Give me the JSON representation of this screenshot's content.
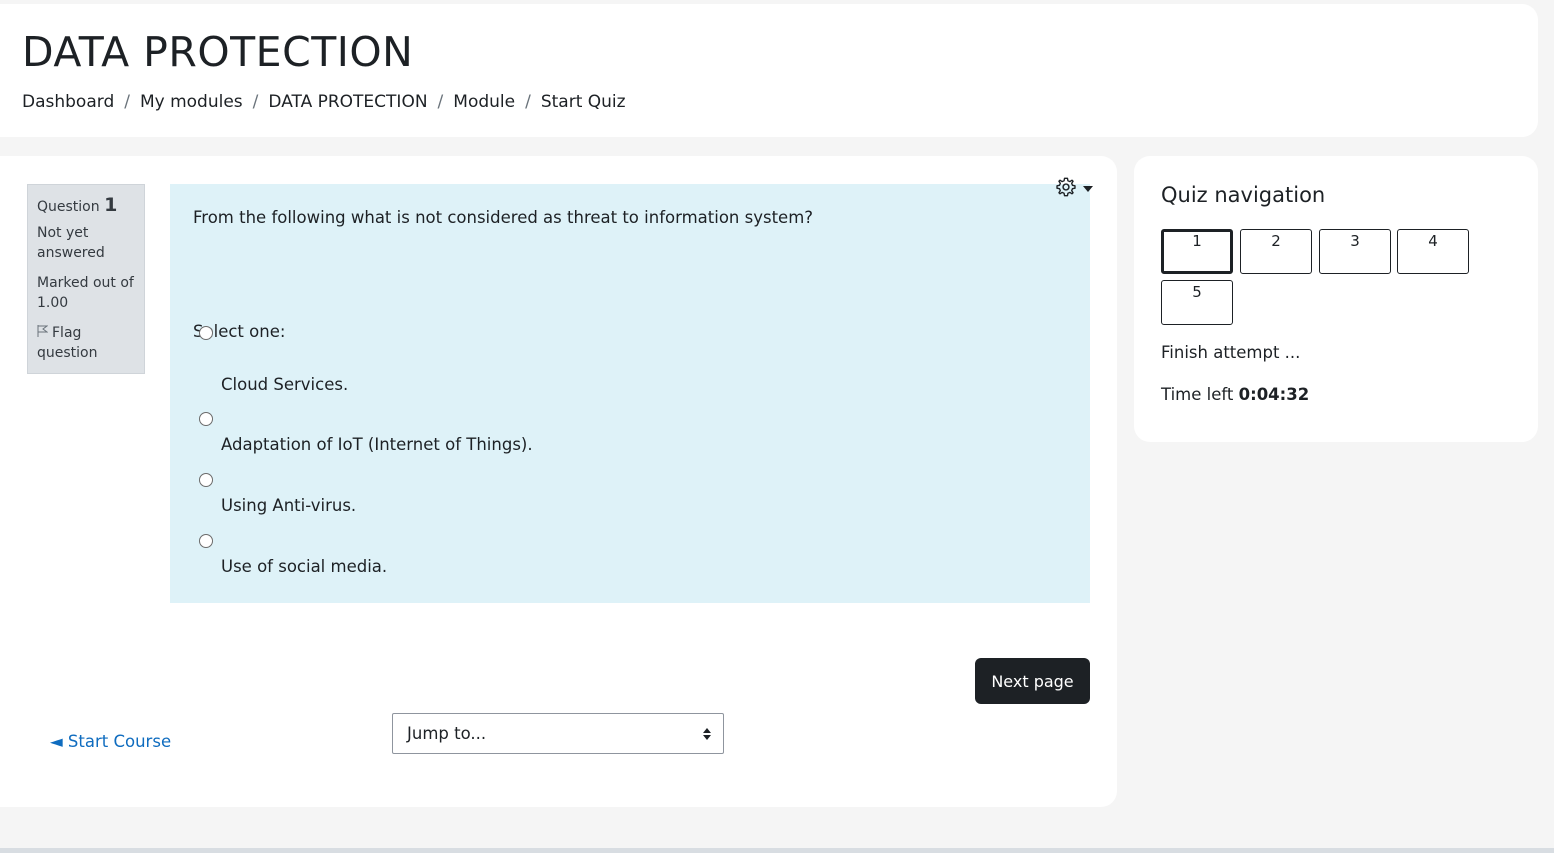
{
  "course": {
    "title": "DATA PROTECTION"
  },
  "breadcrumb": {
    "items": [
      "Dashboard",
      "My modules",
      "DATA PROTECTION",
      "Module",
      "Start Quiz"
    ],
    "separator": "/"
  },
  "question": {
    "label": "Question",
    "number": "1",
    "state": "Not yet answered",
    "grade": "Marked out of 1.00",
    "flag_label": "Flag question",
    "text": "From the following what is not considered as threat to information system?",
    "prompt": "Select one:",
    "options": [
      "Cloud Services.",
      "Adaptation of IoT (Internet of Things).",
      "Using Anti-virus.",
      "Use of social media."
    ]
  },
  "actions": {
    "next_label": "Next page",
    "prev_link": "◄ Start Course",
    "jump_placeholder": "Jump to..."
  },
  "quiz_nav": {
    "title": "Quiz navigation",
    "buttons": [
      "1",
      "2",
      "3",
      "4",
      "5"
    ],
    "current": "1",
    "finish_label": "Finish attempt ...",
    "time_label": "Time left",
    "time_value": "0:04:32"
  },
  "icons": {
    "settings": "gear-icon",
    "flag": "flag-icon",
    "dropdown": "caret-down-icon"
  },
  "colors": {
    "question_bg": "#def2f8",
    "info_bg": "#dee2e6",
    "primary_button": "#1d2125",
    "link": "#0f6cbf",
    "page_bg": "#f5f5f5"
  }
}
